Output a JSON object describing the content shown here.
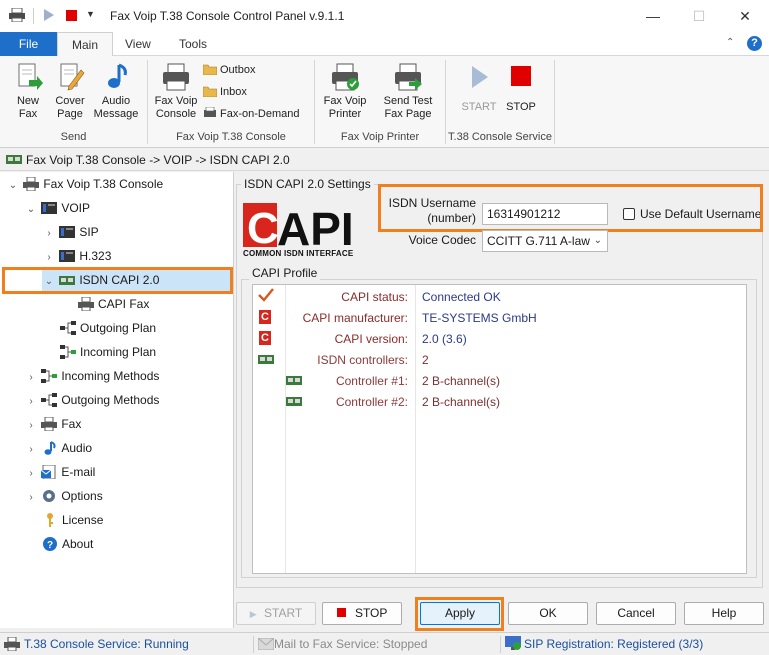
{
  "window": {
    "title": "Fax Voip T.38 Console Control Panel v.9.1.1",
    "minimize": "—",
    "maximize": "☐",
    "close": "✕"
  },
  "ribbon_tabs": [
    "File",
    "Main",
    "View",
    "Tools"
  ],
  "ribbon": {
    "send": {
      "new_fax": "New\nFax",
      "cover_page": "Cover\nPage",
      "audio_message": "Audio\nMessage",
      "label": "Send"
    },
    "console": {
      "fax_voip_console": "Fax Voip\nConsole",
      "outbox": "Outbox",
      "inbox": "Inbox",
      "fax_on_demand": "Fax-on-Demand",
      "label": "Fax Voip T.38 Console"
    },
    "printer": {
      "fax_voip_printer": "Fax Voip\nPrinter",
      "send_test_fax_page": "Send Test\nFax Page",
      "label": "Fax Voip Printer"
    },
    "service": {
      "start": "START",
      "stop": "STOP",
      "label": "T.38 Console Service"
    }
  },
  "breadcrumb": "Fax Voip T.38 Console -> VOIP -> ISDN CAPI 2.0",
  "tree": {
    "root": "Fax Voip T.38 Console",
    "voip": "VOIP",
    "sip": "SIP",
    "h323": "H.323",
    "isdn_capi": "ISDN CAPI 2.0",
    "capi_fax": "CAPI Fax",
    "outgoing_plan": "Outgoing Plan",
    "incoming_plan": "Incoming Plan",
    "incoming_methods": "Incoming Methods",
    "outgoing_methods": "Outgoing Methods",
    "fax": "Fax",
    "audio": "Audio",
    "email": "E-mail",
    "options": "Options",
    "license": "License",
    "about": "About"
  },
  "settings": {
    "group_title": "ISDN CAPI 2.0 Settings",
    "logo_text": "CAPI",
    "logo_subtext": "COMMON ISDN INTERFACE",
    "username_label_1": "ISDN Username",
    "username_label_2": "(number)",
    "username_value": "16314901212",
    "use_default_label": "Use Default Username",
    "use_default_checked": false,
    "voice_codec_label": "Voice Codec",
    "voice_codec_value": "CCITT G.711 A-law"
  },
  "profile": {
    "group_title": "CAPI Profile",
    "rows": [
      {
        "label": "CAPI status:",
        "value": "Connected OK"
      },
      {
        "label": "CAPI manufacturer:",
        "value": "TE-SYSTEMS GmbH"
      },
      {
        "label": "CAPI version:",
        "value": "2.0 (3.6)"
      },
      {
        "label": "ISDN controllers:",
        "value": "2"
      },
      {
        "label": "Controller #1:",
        "value": "2 B-channel(s)"
      },
      {
        "label": "Controller #2:",
        "value": "2 B-channel(s)"
      }
    ]
  },
  "buttons": {
    "start": "START",
    "stop": "STOP",
    "apply": "Apply",
    "ok": "OK",
    "cancel": "Cancel",
    "help": "Help"
  },
  "statusbar": {
    "console_service": "T.38 Console Service: Running",
    "mail_service": "Mail to Fax Service: Stopped",
    "sip_registration": "SIP Registration: Registered (3/3)"
  },
  "colors": {
    "accent": "#1e6fc9",
    "highlight": "#f07f1e",
    "stop_red": "#e00000",
    "selection": "#cce4f7"
  }
}
